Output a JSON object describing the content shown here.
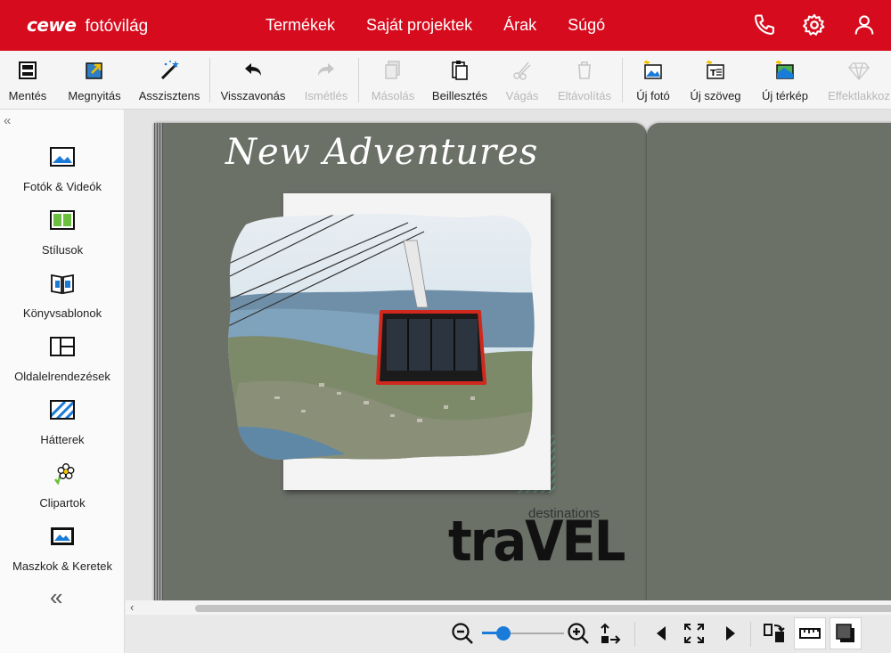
{
  "header": {
    "brand": "cewe",
    "product": "fotóvilág",
    "nav": [
      "Termékek",
      "Saját projektek",
      "Árak",
      "Súgó"
    ],
    "icons": [
      "phone-icon",
      "gear-icon",
      "user-icon"
    ]
  },
  "toolbar": {
    "items": [
      {
        "label": "Mentés",
        "icon": "save-icon",
        "enabled": true
      },
      {
        "label": "Megnyitás",
        "icon": "open-icon",
        "enabled": true
      },
      {
        "label": "Asszisztens",
        "icon": "magic-wand-icon",
        "enabled": true
      },
      {
        "label": "Visszavonás",
        "icon": "undo-icon",
        "enabled": true
      },
      {
        "label": "Ismétlés",
        "icon": "redo-icon",
        "enabled": false
      },
      {
        "label": "Másolás",
        "icon": "copy-icon",
        "enabled": false
      },
      {
        "label": "Beillesztés",
        "icon": "paste-icon",
        "enabled": true
      },
      {
        "label": "Vágás",
        "icon": "cut-icon",
        "enabled": false
      },
      {
        "label": "Eltávolítás",
        "icon": "trash-icon",
        "enabled": false
      },
      {
        "label": "Új fotó",
        "icon": "new-photo-icon",
        "enabled": true
      },
      {
        "label": "Új szöveg",
        "icon": "new-text-icon",
        "enabled": true
      },
      {
        "label": "Új térkép",
        "icon": "new-map-icon",
        "enabled": true
      },
      {
        "label": "Effektlakkoz",
        "icon": "diamond-icon",
        "enabled": false
      }
    ]
  },
  "sidebar": {
    "items": [
      {
        "label": "Fotók & Videók",
        "icon": "photos-icon"
      },
      {
        "label": "Stílusok",
        "icon": "styles-icon"
      },
      {
        "label": "Könyvsablonok",
        "icon": "book-templates-icon"
      },
      {
        "label": "Oldalelrendezések",
        "icon": "layouts-icon"
      },
      {
        "label": "Hátterek",
        "icon": "backgrounds-icon"
      },
      {
        "label": "Clipartok",
        "icon": "clipart-icon"
      },
      {
        "label": "Maszkok & Keretek",
        "icon": "masks-frames-icon"
      }
    ],
    "collapse_top": "«",
    "collapse_bottom": "«"
  },
  "canvas": {
    "title": "New Adventures",
    "subtitle": "destinations",
    "word": "traVEL"
  },
  "colors": {
    "brand_red": "#d60c1e",
    "page_green": "#6c7168",
    "accent_blue": "#1a7bd8"
  }
}
